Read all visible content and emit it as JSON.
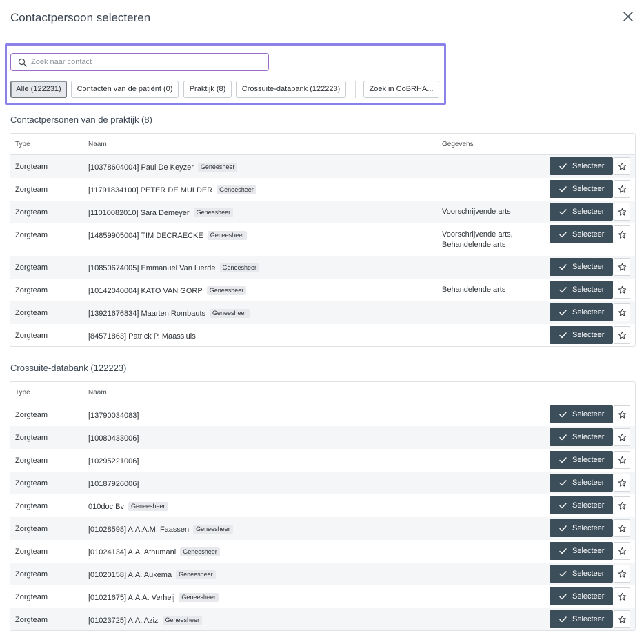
{
  "dialog": {
    "title": "Contactpersoon selecteren"
  },
  "search": {
    "placeholder": "Zoek naar contact",
    "value": ""
  },
  "filters": [
    {
      "label": "Alle (122231)",
      "active": true
    },
    {
      "label": "Contacten van de patiënt (0)",
      "active": false
    },
    {
      "label": "Praktijk (8)",
      "active": false
    },
    {
      "label": "Crossuite-databank (122223)",
      "active": false
    }
  ],
  "cobrha_button": "Zoek in CoBRHA...",
  "practice": {
    "title": "Contactpersonen van de praktijk (8)",
    "headers": {
      "type": "Type",
      "naam": "Naam",
      "gegevens": "Gegevens"
    },
    "rows": [
      {
        "type": "Zorgteam",
        "name": "[10378604004] Paul De Keyzer",
        "badge": "Geneesheer",
        "details": ""
      },
      {
        "type": "Zorgteam",
        "name": "[11791834100] PETER DE MULDER",
        "badge": "Geneesheer",
        "details": ""
      },
      {
        "type": "Zorgteam",
        "name": "[11010082010] Sara Demeyer",
        "badge": "Geneesheer",
        "details": "Voorschrijvende arts"
      },
      {
        "type": "Zorgteam",
        "name": "[14859905004] TIM DECRAECKE",
        "badge": "Geneesheer",
        "details": "Voorschrijvende arts,",
        "details2": "Behandelende arts"
      },
      {
        "type": "Zorgteam",
        "name": "[10850674005] Emmanuel Van Lierde",
        "badge": "Geneesheer",
        "details": ""
      },
      {
        "type": "Zorgteam",
        "name": "[10142040004] KATO VAN GORP",
        "badge": "Geneesheer",
        "details": "Behandelende arts"
      },
      {
        "type": "Zorgteam",
        "name": "[13921676834] Maarten Rombauts",
        "badge": "Geneesheer",
        "details": ""
      },
      {
        "type": "Zorgteam",
        "name": "[84571863] Patrick P. Maassluis",
        "badge": "",
        "details": ""
      }
    ]
  },
  "crossuite": {
    "title": "Crossuite-databank (122223)",
    "headers": {
      "type": "Type",
      "naam": "Naam"
    },
    "rows": [
      {
        "type": "Zorgteam",
        "name": "[13790034083]",
        "badge": ""
      },
      {
        "type": "Zorgteam",
        "name": "[10080433006]",
        "badge": ""
      },
      {
        "type": "Zorgteam",
        "name": "[10295221006]",
        "badge": ""
      },
      {
        "type": "Zorgteam",
        "name": "[10187926006]",
        "badge": ""
      },
      {
        "type": "Zorgteam",
        "name": "010doc Bv",
        "badge": "Geneesheer"
      },
      {
        "type": "Zorgteam",
        "name": "[01028598] A.A.A.M. Faassen",
        "badge": "Geneesheer"
      },
      {
        "type": "Zorgteam",
        "name": "[01024134] A.A. Athumani",
        "badge": "Geneesheer"
      },
      {
        "type": "Zorgteam",
        "name": "[01020158] A.A. Aukema",
        "badge": "Geneesheer"
      },
      {
        "type": "Zorgteam",
        "name": "[01021675] A.A.A. Verheij",
        "badge": "Geneesheer"
      },
      {
        "type": "Zorgteam",
        "name": "[01023725] A.A. Aziz",
        "badge": "Geneesheer"
      }
    ]
  },
  "select_label": "Selecteer",
  "icons": {
    "close": "close-icon",
    "search": "search-icon",
    "check": "check-icon",
    "star": "star-icon"
  },
  "colors": {
    "accent": "#8a82e8",
    "button": "#3d4e5b",
    "search_border": "#9a6cc7"
  }
}
